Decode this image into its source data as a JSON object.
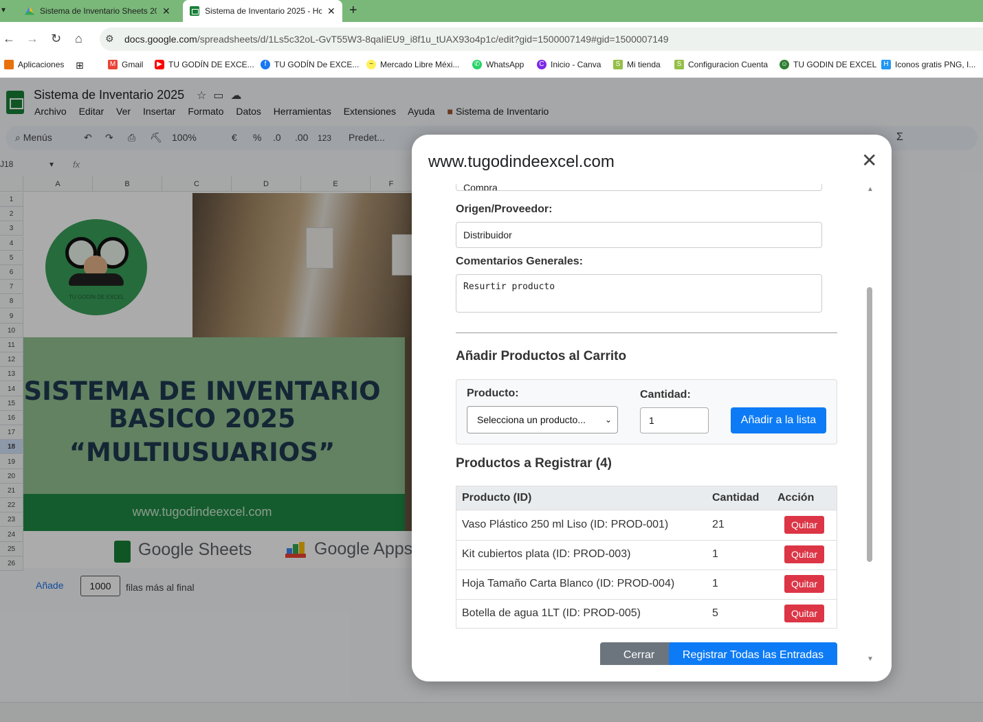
{
  "browser": {
    "tabs": [
      {
        "title": "Sistema de Inventario Sheets 20"
      },
      {
        "title": "Sistema de Inventario 2025 - Hc"
      }
    ],
    "url_domain": "docs.google.com",
    "url_path": "/spreadsheets/d/1Ls5c32oL-GvT55W3-8qaIiEU9_i8f1u_tUAX93o4p1c/edit?gid=1500007149#gid=1500007149",
    "bookmarks": [
      "Aplicaciones",
      "Gmail",
      "TU GODÍN DE EXCE...",
      "TU GODÍN De EXCE...",
      "Mercado Libre Méxi...",
      "WhatsApp",
      "Inicio - Canva",
      "Mi tienda",
      "Configuracion Cuenta",
      "TU GODIN DE EXCEL",
      "Iconos gratis PNG, I..."
    ]
  },
  "sheets": {
    "doc_title": "Sistema de Inventario 2025",
    "menu": [
      "Archivo",
      "Editar",
      "Ver",
      "Insertar",
      "Formato",
      "Datos",
      "Herramientas",
      "Extensiones",
      "Ayuda",
      "Sistema de Inventario"
    ],
    "toolbar": {
      "search": "Menús",
      "zoom": "100%",
      "currency": "€",
      "percent": "%",
      "dec_minus": ".0",
      "dec_plus": ".00",
      "number_format": "123",
      "font": "Predet..."
    },
    "namebox": "J18",
    "fx": "fx",
    "columns": [
      "A",
      "B",
      "C",
      "D",
      "E",
      "F"
    ],
    "rows": [
      "1",
      "2",
      "3",
      "4",
      "5",
      "6",
      "7",
      "8",
      "9",
      "10",
      "11",
      "12",
      "13",
      "14",
      "15",
      "16",
      "17",
      "18",
      "19",
      "20",
      "21",
      "22",
      "23",
      "24",
      "25",
      "26"
    ],
    "logo_text": "TU GODIN DE EXCEL",
    "banner": {
      "line1": "SISTEMA DE INVENTARIO",
      "line2": "BASICO 2025",
      "line3": "“MULTIUSUARIOS”",
      "url": "www.tugodindeexcel.com",
      "brand1": "Google Sheets",
      "brand2": "Google Apps"
    },
    "add_rows": {
      "label": "Añade",
      "value": "1000",
      "suffix": "filas más al final"
    }
  },
  "modal": {
    "title": "www.tugodindeexcel.com",
    "type_value_partial": "Compra",
    "origin_label": "Origen/Proveedor:",
    "origin_value": "Distribuidor",
    "comments_label": "Comentarios Generales:",
    "comments_value": "Resurtir producto",
    "cart_heading": "Añadir Productos al Carrito",
    "product_label": "Producto:",
    "product_select": "Selecciona un producto...",
    "qty_label": "Cantidad:",
    "qty_value": "1",
    "add_button": "Añadir a la lista",
    "list_heading": "Productos a Registrar (4)",
    "table": {
      "headers": [
        "Producto (ID)",
        "Cantidad",
        "Acción"
      ],
      "rows": [
        {
          "product": "Vaso Plástico 250 ml Liso (ID: PROD-001)",
          "qty": "21",
          "action": "Quitar"
        },
        {
          "product": "Kit cubiertos plata (ID: PROD-003)",
          "qty": "1",
          "action": "Quitar"
        },
        {
          "product": "Hoja Tamaño Carta Blanco (ID: PROD-004)",
          "qty": "1",
          "action": "Quitar"
        },
        {
          "product": "Botella de agua 1LT (ID: PROD-005)",
          "qty": "5",
          "action": "Quitar"
        }
      ]
    },
    "close_button": "Cerrar",
    "submit_button": "Registrar Todas las Entradas"
  }
}
